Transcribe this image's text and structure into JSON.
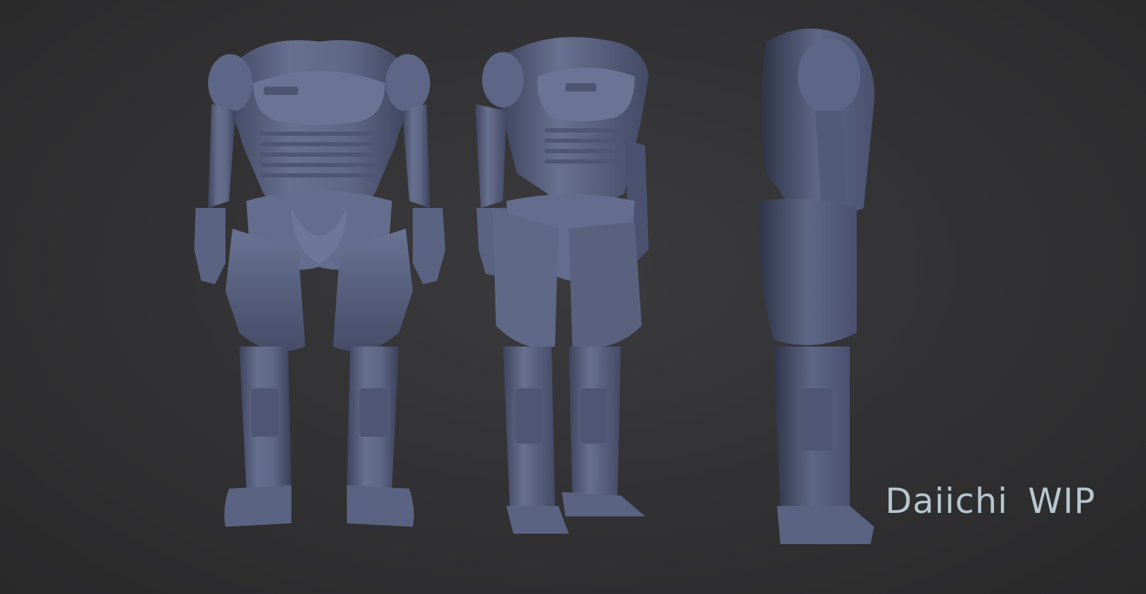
{
  "caption": {
    "text": "Daiichi  WIP",
    "color": "#b7c6cf"
  },
  "render": {
    "subject": "armored-suit-sculpt",
    "views": [
      "front",
      "three-quarter",
      "side"
    ],
    "clay_color": "#5b6383",
    "background_color": "#333335"
  }
}
